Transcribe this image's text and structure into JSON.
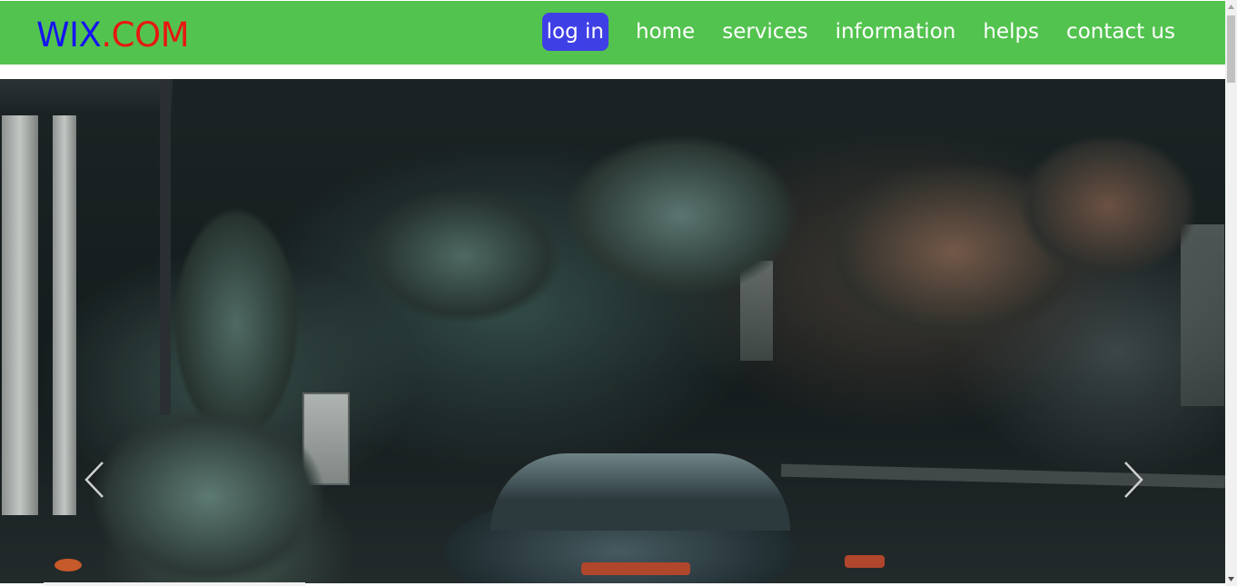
{
  "brand": {
    "part1": "WIX",
    "part2": ".COM",
    "color1": "#1515f0",
    "color2": "#e8170f"
  },
  "nav": {
    "login": "log in",
    "items": [
      {
        "label": "home"
      },
      {
        "label": "services"
      },
      {
        "label": "information"
      },
      {
        "label": "helps"
      },
      {
        "label": "contact us"
      }
    ]
  },
  "colors": {
    "navbar": "#53c34f",
    "login": "#3f3fe6"
  },
  "carousel": {
    "prev_icon": "chevron-left-icon",
    "next_icon": "chevron-right-icon"
  }
}
